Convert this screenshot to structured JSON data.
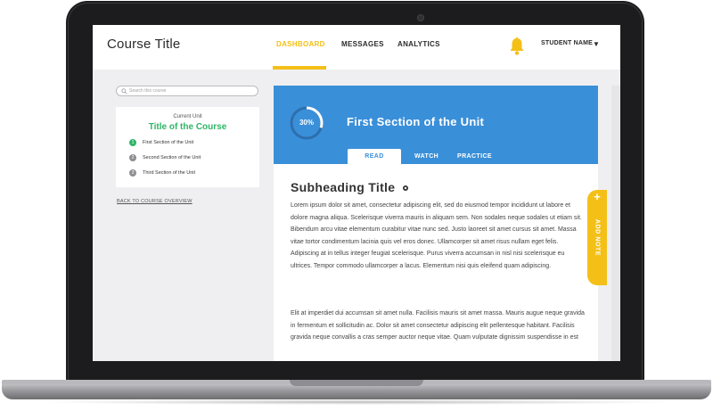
{
  "header": {
    "course_title": "Course Title",
    "nav": [
      {
        "label": "DASHBOARD",
        "active": true
      },
      {
        "label": "MESSAGES",
        "active": false
      },
      {
        "label": "ANALYTICS",
        "active": false
      }
    ],
    "student_name": "STUDENT NAME",
    "student_caret": "▼",
    "bell_icon": "bell-icon"
  },
  "sidebar": {
    "search_placeholder": "Search this course",
    "current_unit_label": "Current Unit",
    "unit_title": "Title of the Course",
    "items": [
      {
        "num": "1",
        "label": "First Section of the Unit",
        "done": true
      },
      {
        "num": "2",
        "label": "Second Section of the Unit",
        "done": false
      },
      {
        "num": "3",
        "label": "Third Section of the Unit",
        "done": false
      }
    ],
    "back_link": "BACK TO COURSE OVERVIEW"
  },
  "main": {
    "progress": 0.3,
    "progress_label": "30%",
    "section_title": "First Section of the Unit",
    "tabs": [
      {
        "label": "READ",
        "active": true
      },
      {
        "label": "WATCH",
        "active": false
      },
      {
        "label": "PRACTICE",
        "active": false
      }
    ],
    "subheading": "Subheading Title",
    "paragraph1": "Lorem ipsum dolor sit amet, consectetur adipiscing elit, sed do eiusmod tempor incididunt ut labore et dolore magna aliqua. Scelerisque viverra mauris in aliquam sem. Non sodales neque sodales ut etiam sit. Bibendum arcu vitae elementum curabitur vitae nunc sed. Justo laoreet sit amet cursus sit amet. Massa vitae tortor condimentum lacinia quis vel eros donec. Ullamcorper sit amet risus nullam eget felis. Adipiscing at in tellus integer feugiat scelerisque. Purus viverra accumsan in nisl nisi scelerisque eu ultrices. Tempor commodo ullamcorper a lacus. Elementum nisi quis eleifend quam adipiscing.",
    "paragraph2": "Elit at imperdiet dui accumsan sit amet nulla. Facilisis mauris sit amet massa. Mauris augue neque gravida in fermentum et sollicitudin ac. Dolor sit amet consectetur adipiscing elit pellentesque habitant. Facilisis gravida neque convallis a cras semper auctor neque vitae. Quam vulputate dignissim suspendisse in est",
    "add_note": "ADD NOTE"
  },
  "colors": {
    "accent_yellow": "#f4c018",
    "accent_green": "#2fb566",
    "accent_blue": "#3a8fd9"
  }
}
